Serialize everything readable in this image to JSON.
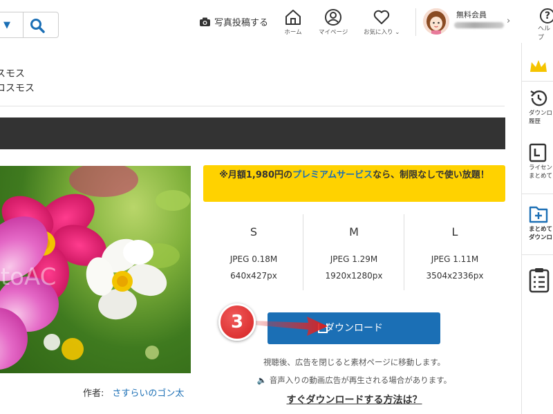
{
  "header": {
    "post_photo": "写真投稿する",
    "nav": {
      "home": "ホーム",
      "mypage": "マイページ",
      "favorites": "お気に入り ⌄"
    },
    "member_label": "無料会員",
    "help": "ヘルプ"
  },
  "breadcrumb": {
    "line1": "スモス",
    "line2": "コスモス"
  },
  "title_bar": "　",
  "photo": {
    "watermark": "otoAC",
    "author_label": "作者:",
    "author_name": "さすらいのゴン太"
  },
  "premium": {
    "prefix": "※月額1,980円の",
    "highlight": "プレミアムサービス",
    "suffix": "なら、制限なしで使い放題！"
  },
  "sizes": [
    {
      "label": "S",
      "format": "JPEG 0.18M",
      "dims": "640x427px"
    },
    {
      "label": "M",
      "format": "JPEG 1.29M",
      "dims": "1920x1280px"
    },
    {
      "label": "L",
      "format": "JPEG 1.11M",
      "dims": "3504x2336px"
    }
  ],
  "download": {
    "button_label": "ダウンロード",
    "step_number": "3",
    "note1": "視聴後、広告を閉じると素材ページに移動します。",
    "note2": "🔈 音声入りの動画広告が再生される場合があります。",
    "howto": "すぐダウンロードする方法は？"
  },
  "sidebar": {
    "history": [
      "ダウンロ",
      "履歴"
    ],
    "license": [
      "ライセン",
      "まとめて"
    ],
    "bulk": [
      "まとめて",
      "ダウンロ"
    ]
  },
  "colors": {
    "accent_blue": "#1b6fb5",
    "premium_yellow": "#ffd200",
    "step_red": "#d52222",
    "title_bar": "#333333"
  }
}
